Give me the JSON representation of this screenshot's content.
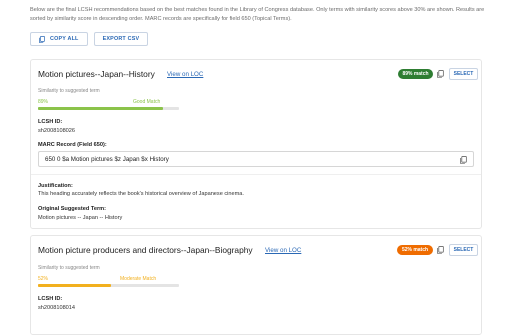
{
  "intro": {
    "text": "Below are the final LCSH recommendations based on the best matches found in the Library of Congress database. Only terms with similarity scores above 30% are shown. Results are sorted by similarity score in descending order. MARC records are specifically for field 650 (Topical Terms)."
  },
  "actions": {
    "copy_all_label": "COPY ALL",
    "export_csv_label": "EXPORT CSV"
  },
  "results": [
    {
      "title": "Motion pictures--Japan--History",
      "view_link": "View on LOC",
      "badge": "89% match",
      "badge_color": "#2e7d32",
      "select_label": "SELECT",
      "similarity_label": "Similarity to suggested term",
      "percent_text": "89%",
      "match_quality": "Good Match",
      "match_color": "#8bc34a",
      "similarity": 0.89,
      "lcsh_label": "LCSH ID:",
      "lcsh_id": "sh2008108026",
      "marc_label": "MARC Record (Field 650):",
      "marc_value": "650  0 $a Motion pictures $z Japan $x History",
      "justification_label": "Justification:",
      "justification": "This heading accurately reflects the book's historical overview of Japanese cinema.",
      "original_label": "Original Suggested Term:",
      "original_term": "Motion pictures -- Japan -- History"
    },
    {
      "title": "Motion picture producers and directors--Japan--Biography",
      "view_link": "View on LOC",
      "badge": "52% match",
      "badge_color": "#ef6c00",
      "select_label": "SELECT",
      "similarity_label": "Similarity to suggested term",
      "percent_text": "52%",
      "match_quality": "Moderate Match",
      "match_color": "#f2b01e",
      "similarity": 0.52,
      "lcsh_label": "LCSH ID:",
      "lcsh_id": "sh2008108014"
    }
  ]
}
